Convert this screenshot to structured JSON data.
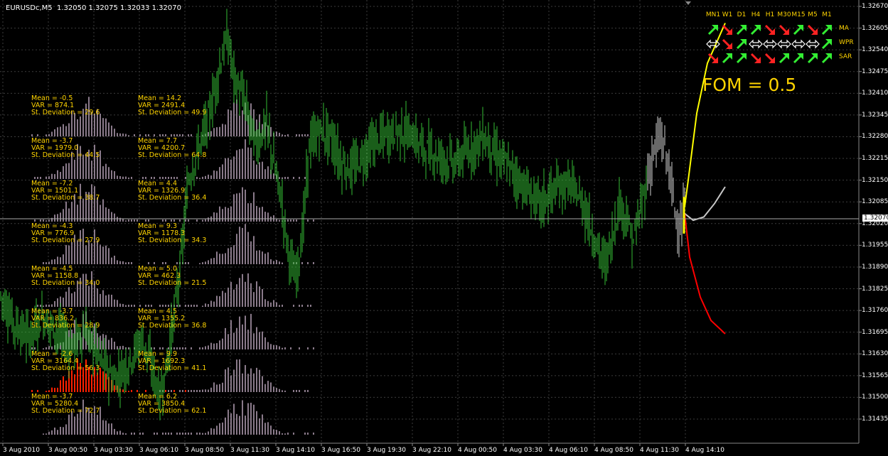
{
  "header": {
    "symbol": "EURUSDc,M5",
    "ohlc": "1.32050 1.32075 1.32033 1.32070"
  },
  "fom_label": "FOM = 0.5",
  "current_price": "1.32070",
  "colors": {
    "background": "#000000",
    "candles": "#33bb33",
    "grid": "#3c3c3c",
    "histogram": "#8a7a8a",
    "histogram_highlight": "#ff2000",
    "stats_text": "#ffd400",
    "forecast_up": "#ffff00",
    "forecast_mid": "#c8c8c8",
    "forecast_down": "#ff0000",
    "arrow_up": "#33ee33",
    "arrow_down": "#ff2222",
    "arrow_neutral": "#ffffff"
  },
  "indicator_panel": {
    "timeframes": [
      "MN1",
      "W1",
      "D1",
      "H4",
      "H1",
      "M30",
      "M15",
      "M5",
      "M1"
    ],
    "rows": [
      {
        "name": "MA",
        "signals": [
          "up",
          "down",
          "up",
          "up",
          "down",
          "down",
          "up",
          "down",
          "up"
        ]
      },
      {
        "name": "WPR",
        "signals": [
          "neutral",
          "down",
          "up",
          "neutral",
          "neutral",
          "neutral",
          "neutral",
          "neutral",
          "up"
        ]
      },
      {
        "name": "SAR",
        "signals": [
          "down",
          "up",
          "up",
          "down",
          "down",
          "up",
          "up",
          "up",
          "up"
        ]
      }
    ]
  },
  "stats_columns": [
    [
      {
        "mean": "Mean = -0.5",
        "var": "VAR = 874.1",
        "sd": "St. Deviation = 29.6"
      },
      {
        "mean": "Mean = -3.7",
        "var": "VAR = 1979.0",
        "sd": "St. Deviation = 44.5"
      },
      {
        "mean": "Mean = -7.2",
        "var": "VAR = 1501.1",
        "sd": "St. Deviation = 38.7"
      },
      {
        "mean": "Mean = -4.3",
        "var": "VAR = 776.9",
        "sd": "St. Deviation = 27.9"
      },
      {
        "mean": "Mean = -4.5",
        "var": "VAR = 1158.8",
        "sd": "St. Deviation = 34.0"
      },
      {
        "mean": "Mean = -3.7",
        "var": "VAR = 836.2",
        "sd": "St. Deviation = 28.9"
      },
      {
        "mean": "Mean = -2.6",
        "var": "VAR = 3164.4",
        "sd": "St. Deviation = 56.3"
      },
      {
        "mean": "Mean = -3.7",
        "var": "VAR = 5280.4",
        "sd": "St. Deviation = 72.7"
      }
    ],
    [
      {
        "mean": "Mean = 14.2",
        "var": "VAR = 2491.4",
        "sd": "St. Deviation = 49.9"
      },
      {
        "mean": "Mean = 7.7",
        "var": "VAR = 4200.7",
        "sd": "St. Deviation = 64.8"
      },
      {
        "mean": "Mean = 4.4",
        "var": "VAR = 1326.9",
        "sd": "St. Deviation = 36.4"
      },
      {
        "mean": "Mean = 9.3",
        "var": "VAR = 1178.3",
        "sd": "St. Deviation = 34.3"
      },
      {
        "mean": "Mean = 5.0",
        "var": "VAR = 462.3",
        "sd": "St. Deviation = 21.5"
      },
      {
        "mean": "Mean = 4.5",
        "var": "VAR = 1355.2",
        "sd": "St. Deviation = 36.8"
      },
      {
        "mean": "Mean = 9.9",
        "var": "VAR = 1692.3",
        "sd": "St. Deviation = 41.1"
      },
      {
        "mean": "Mean = 6.2",
        "var": "VAR = 3850.4",
        "sd": "St. Deviation = 62.1"
      }
    ]
  ],
  "chart_data": {
    "type": "candlestick",
    "ylim": [
      1.31435,
      1.3267
    ],
    "price_ticks": [
      "1.32670",
      "1.32605",
      "1.32540",
      "1.32475",
      "1.32410",
      "1.32345",
      "1.32280",
      "1.32215",
      "1.32150",
      "1.32085",
      "1.32020",
      "1.31955",
      "1.31890",
      "1.31825",
      "1.31760",
      "1.31695",
      "1.31630",
      "1.31565",
      "1.31500",
      "1.31435"
    ],
    "time_ticks": [
      "3 Aug 2010",
      "3 Aug 00:50",
      "3 Aug 03:30",
      "3 Aug 06:10",
      "3 Aug 08:50",
      "3 Aug 11:30",
      "3 Aug 14:10",
      "3 Aug 16:50",
      "3 Aug 19:30",
      "3 Aug 22:10",
      "4 Aug 00:50",
      "4 Aug 03:30",
      "4 Aug 06:10",
      "4 Aug 08:50",
      "4 Aug 11:30",
      "4 Aug 14:10"
    ],
    "price_path": [
      [
        0,
        1.3181
      ],
      [
        20,
        1.3172
      ],
      [
        40,
        1.3168
      ],
      [
        60,
        1.3174
      ],
      [
        80,
        1.317
      ],
      [
        100,
        1.3165
      ],
      [
        120,
        1.317
      ],
      [
        140,
        1.3162
      ],
      [
        160,
        1.3155
      ],
      [
        180,
        1.316
      ],
      [
        200,
        1.3168
      ],
      [
        215,
        1.3158
      ],
      [
        225,
        1.315
      ],
      [
        235,
        1.316
      ],
      [
        245,
        1.3175
      ],
      [
        255,
        1.3192
      ],
      [
        265,
        1.3215
      ],
      [
        280,
        1.3225
      ],
      [
        295,
        1.3235
      ],
      [
        310,
        1.325
      ],
      [
        320,
        1.3258
      ],
      [
        330,
        1.3245
      ],
      [
        345,
        1.3238
      ],
      [
        360,
        1.3225
      ],
      [
        375,
        1.3232
      ],
      [
        385,
        1.322
      ],
      [
        395,
        1.321
      ],
      [
        405,
        1.3195
      ],
      [
        415,
        1.3185
      ],
      [
        425,
        1.3198
      ],
      [
        435,
        1.3225
      ],
      [
        450,
        1.323
      ],
      [
        465,
        1.3228
      ],
      [
        480,
        1.322
      ],
      [
        495,
        1.3218
      ],
      [
        510,
        1.3222
      ],
      [
        525,
        1.3226
      ],
      [
        540,
        1.3228
      ],
      [
        560,
        1.323
      ],
      [
        580,
        1.3228
      ],
      [
        600,
        1.3224
      ],
      [
        620,
        1.3222
      ],
      [
        640,
        1.322
      ],
      [
        660,
        1.3224
      ],
      [
        680,
        1.3228
      ],
      [
        700,
        1.3222
      ],
      [
        720,
        1.3218
      ],
      [
        740,
        1.3212
      ],
      [
        760,
        1.3208
      ],
      [
        780,
        1.3212
      ],
      [
        800,
        1.3214
      ],
      [
        820,
        1.3208
      ],
      [
        835,
        1.3198
      ],
      [
        850,
        1.319
      ],
      [
        860,
        1.3196
      ],
      [
        870,
        1.3208
      ],
      [
        880,
        1.3205
      ],
      [
        890,
        1.3196
      ],
      [
        900,
        1.3205
      ],
      [
        910,
        1.3215
      ],
      [
        920,
        1.3224
      ],
      [
        930,
        1.3228
      ],
      [
        940,
        1.322
      ],
      [
        950,
        1.3205
      ],
      [
        958,
        1.32
      ],
      [
        963,
        1.3207
      ]
    ],
    "forecast": {
      "upper": [
        [
          963,
          1.3207
        ],
        [
          968,
          1.3215
        ],
        [
          980,
          1.3235
        ],
        [
          995,
          1.325
        ],
        [
          1020,
          1.3262
        ]
      ],
      "middle": [
        [
          963,
          1.3205
        ],
        [
          975,
          1.3203
        ],
        [
          990,
          1.3204
        ],
        [
          1005,
          1.3208
        ],
        [
          1020,
          1.3213
        ]
      ],
      "lower": [
        [
          963,
          1.3205
        ],
        [
          970,
          1.3192
        ],
        [
          985,
          1.318
        ],
        [
          1000,
          1.3173
        ],
        [
          1020,
          1.3169
        ]
      ]
    }
  }
}
